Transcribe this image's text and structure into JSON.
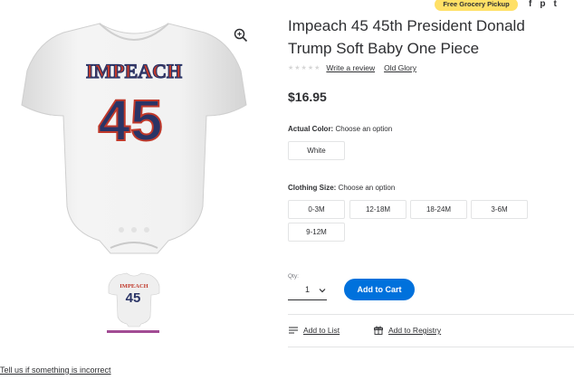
{
  "promo": {
    "pickup": "Free Grocery Pickup"
  },
  "share": {
    "facebook": "f",
    "pinterest": "p",
    "twitter": "t"
  },
  "product": {
    "title": "Impeach 45 45th President Donald Trump Soft Baby One Piece",
    "rating_stars": "★★★★★",
    "write_review": "Write a review",
    "brand": "Old Glory",
    "price": "$16.95",
    "onesie_text_top": "IMPEACH",
    "onesie_text_num": "45"
  },
  "color_option": {
    "label": "Actual Color:",
    "prompt": "Choose an option",
    "values": [
      "White"
    ]
  },
  "size_option": {
    "label": "Clothing Size:",
    "prompt": "Choose an option",
    "values": [
      "0-3M",
      "12-18M",
      "18-24M",
      "3-6M",
      "9-12M"
    ]
  },
  "quantity": {
    "label": "Qty:",
    "value": "1"
  },
  "cart": {
    "add_label": "Add to Cart"
  },
  "actions": {
    "add_list": "Add to List",
    "add_registry": "Add to Registry"
  },
  "footer": {
    "report": "Tell us if something is incorrect"
  },
  "colors": {
    "accent": "#0071dc",
    "badge": "#ffe066",
    "thumb_indicator": "#a24c94",
    "onesie_navy": "#2a3466",
    "onesie_red": "#c0392b"
  }
}
